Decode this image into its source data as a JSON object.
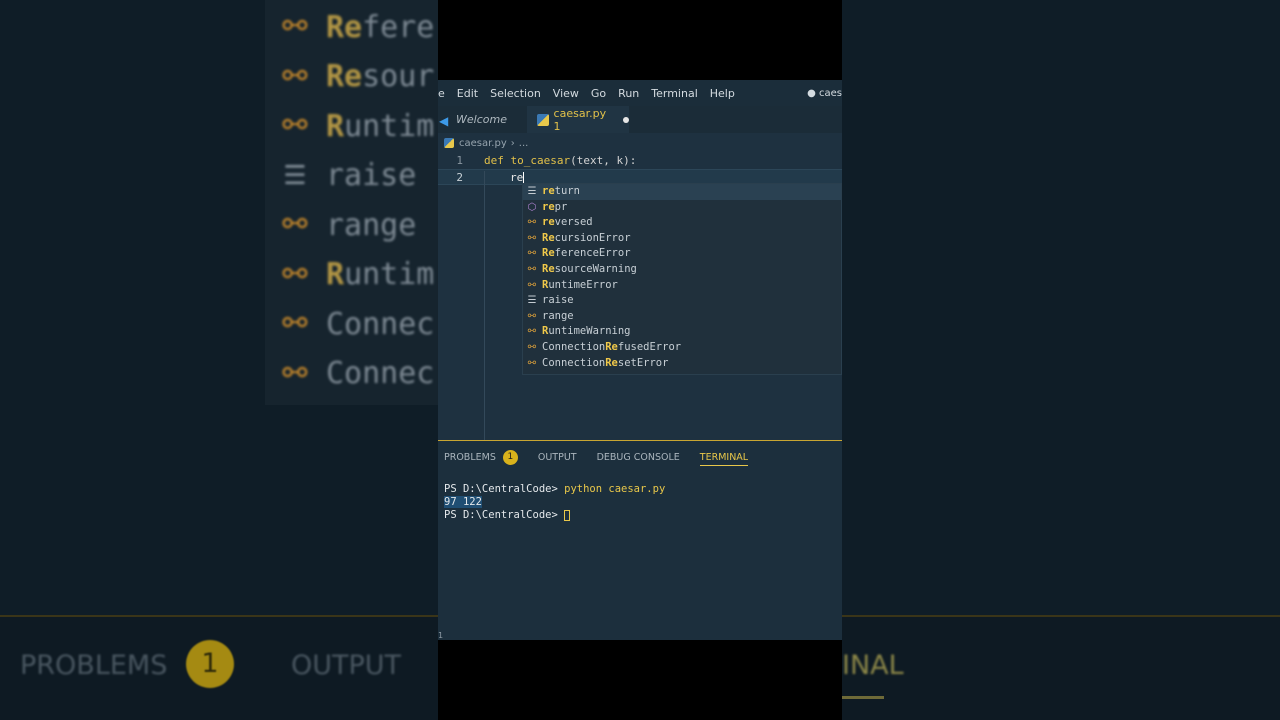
{
  "background": {
    "items": [
      {
        "icon": "class-icon",
        "label_hl": "Re",
        "label_rest": "fere"
      },
      {
        "icon": "class-icon",
        "label_hl": "Re",
        "label_rest": "sour"
      },
      {
        "icon": "class-icon",
        "label_hl": "R",
        "label_rest": "untim"
      },
      {
        "icon": "keyword-icon",
        "label_hl": "",
        "label_rest": "raise"
      },
      {
        "icon": "class-icon",
        "label_hl": "",
        "label_rest": "range"
      },
      {
        "icon": "class-icon",
        "label_hl": "R",
        "label_rest": "untim"
      },
      {
        "icon": "class-icon",
        "label_hl": "",
        "label_rest": "Connec"
      },
      {
        "icon": "class-icon",
        "label_hl": "",
        "label_rest": "Connec"
      }
    ],
    "bottom_problems": "PROBLEMS",
    "bottom_badge": "1",
    "bottom_output": "OUTPUT",
    "bottom_terminal": "INAL"
  },
  "menubar": {
    "first_fragment": "e",
    "items": [
      "Edit",
      "Selection",
      "View",
      "Go",
      "Run",
      "Terminal",
      "Help"
    ],
    "title_fragment": "● caes"
  },
  "tabs": {
    "welcome": "Welcome",
    "active": "caesar.py 1"
  },
  "breadcrumb": {
    "file": "caesar.py",
    "rest": "..."
  },
  "code": {
    "line1_num": "1",
    "line1_kw": "def",
    "line1_fn": "to_caesar",
    "line1_rest": "(text, k):",
    "line2_num": "2",
    "line2_typed": "re"
  },
  "suggestions": [
    {
      "icon": "keyword-icon",
      "hl": "re",
      "rest": "turn"
    },
    {
      "icon": "cube-icon",
      "hl": "re",
      "rest": "pr"
    },
    {
      "icon": "class-icon",
      "hl": "re",
      "rest": "versed"
    },
    {
      "icon": "class-icon",
      "hl": "Re",
      "rest": "cursionError"
    },
    {
      "icon": "class-icon",
      "hl": "Re",
      "rest": "ferenceError"
    },
    {
      "icon": "class-icon",
      "hl": "Re",
      "rest": "sourceWarning"
    },
    {
      "icon": "class-icon",
      "hl": "R",
      "rest": "untimeError"
    },
    {
      "icon": "keyword-icon",
      "hl": "",
      "rest": "raise"
    },
    {
      "icon": "class-icon",
      "hl": "",
      "rest": "range"
    },
    {
      "icon": "class-icon",
      "hl": "R",
      "rest": "untimeWarning"
    },
    {
      "icon": "class-icon",
      "pre": "Connection",
      "hl": "Re",
      "rest": "fusedError"
    },
    {
      "icon": "class-icon",
      "pre": "Connection",
      "hl": "Re",
      "rest": "setError"
    }
  ],
  "panel": {
    "problems": "PROBLEMS",
    "problems_count": "1",
    "output": "OUTPUT",
    "debug": "DEBUG CONSOLE",
    "terminal": "TERMINAL"
  },
  "terminal": {
    "prompt1": "PS D:\\CentralCode>",
    "cmd": "python caesar.py",
    "output": "97 122",
    "prompt2": "PS D:\\CentralCode>"
  },
  "status": {
    "left_num": "1"
  },
  "colors": {
    "accent": "#e2c049",
    "editor_bg": "#1e3140",
    "selection": "#1f4e73"
  }
}
